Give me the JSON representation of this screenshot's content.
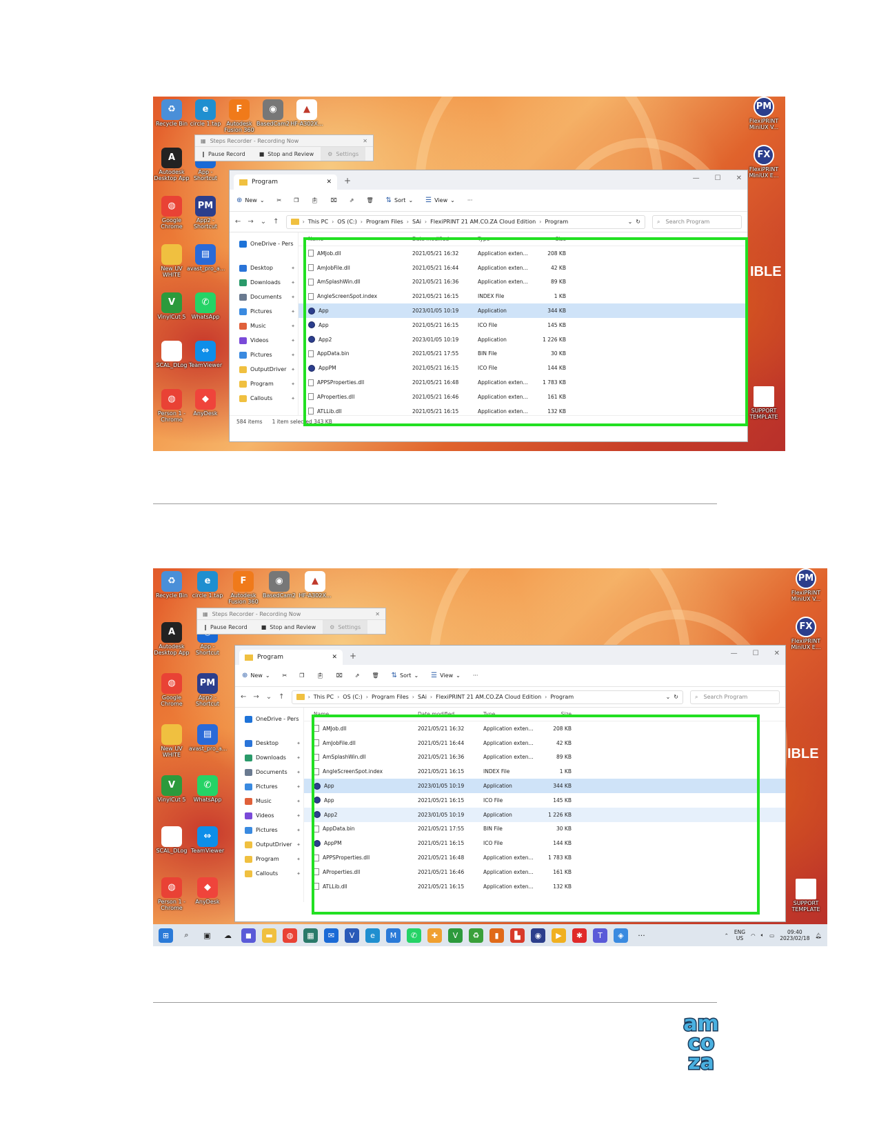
{
  "screens": [
    {
      "desktop_icons": [
        {
          "label": "Recycle Bin",
          "icon": "recycle-bin-icon",
          "color": "#4a8fd8",
          "glyph": "♻"
        },
        {
          "label": "circle 1.tap",
          "icon": "edge-icon",
          "color": "#1f8fd0",
          "glyph": "e"
        },
        {
          "label": "Autodesk Fusion 360",
          "icon": "fusion-icon",
          "color": "#f07a1a",
          "glyph": "F"
        },
        {
          "label": "BasedCam2",
          "icon": "camera-icon",
          "color": "#777777",
          "glyph": "◉"
        },
        {
          "label": "HF-A302X...",
          "icon": "triangle-app-icon",
          "color": "#ffffff",
          "glyph": "▲"
        },
        {
          "label": "Autodesk Desktop App",
          "icon": "autodesk-icon",
          "color": "#222222",
          "glyph": "A"
        },
        {
          "label": "App - Shortcut",
          "icon": "app-shortcut-icon",
          "color": "#1a6ad6",
          "glyph": "◎"
        },
        {
          "label": "Google Chrome",
          "icon": "chrome-icon",
          "color": "#e94235",
          "glyph": "◍"
        },
        {
          "label": "App2 - Shortcut",
          "icon": "pm-icon",
          "color": "#2c3e8c",
          "glyph": "PM"
        },
        {
          "label": "New UV WHITE",
          "icon": "folder-icon",
          "color": "#f0c040",
          "glyph": ""
        },
        {
          "label": "avast_pro_a...",
          "icon": "archive-icon",
          "color": "#2a6ad8",
          "glyph": "▤"
        },
        {
          "label": "VinylCut 5",
          "icon": "vinylcut-icon",
          "color": "#2c9a3c",
          "glyph": "V"
        },
        {
          "label": "WhatsApp",
          "icon": "whatsapp-icon",
          "color": "#25d366",
          "glyph": "✆"
        },
        {
          "label": "SCAL_DLog",
          "icon": "document-icon",
          "color": "#ffffff",
          "glyph": ""
        },
        {
          "label": "TeamViewer",
          "icon": "teamviewer-icon",
          "color": "#0e8ee9",
          "glyph": "⇔"
        },
        {
          "label": "Person 1 - Chrome",
          "icon": "chrome-profile-icon",
          "color": "#e94235",
          "glyph": "◍"
        },
        {
          "label": "AnyDesk",
          "icon": "anydesk-icon",
          "color": "#ef443b",
          "glyph": "◆"
        }
      ],
      "right_icons": [
        {
          "label": "FlexiPRINT MiniUX V...",
          "icon": "pm-circle-icon",
          "glyph": "PM"
        },
        {
          "label": "FlexiPRINT MiniUX E...",
          "icon": "fx-circle-icon",
          "glyph": "FX"
        },
        {
          "label": "SUPPORT TEMPLATE",
          "icon": "support-doc-icon",
          "glyph": ""
        }
      ],
      "wallpaper_text": "IBLE"
    }
  ],
  "steps_recorder": {
    "title": "Steps Recorder - Recording Now",
    "pause": "Pause Record",
    "stop": "Stop and Review",
    "settings": "Settings"
  },
  "explorer": {
    "tab_title": "Program",
    "commands": {
      "new": "New",
      "sort": "Sort",
      "view": "View",
      "more": "···"
    },
    "breadcrumb": [
      "This PC",
      "OS (C:)",
      "Program Files",
      "SAi",
      "FlexiPRINT 21 AM.CO.ZA Cloud Edition",
      "Program"
    ],
    "search_placeholder": "Search Program",
    "nav": [
      {
        "label": "OneDrive - Pers",
        "color": "#1e73d8"
      },
      {
        "label": "Desktop",
        "color": "#2a74d8",
        "pin": true
      },
      {
        "label": "Downloads",
        "color": "#2a9a6a",
        "pin": true
      },
      {
        "label": "Documents",
        "color": "#6a7a90",
        "pin": true
      },
      {
        "label": "Pictures",
        "color": "#3a8ae0",
        "pin": true
      },
      {
        "label": "Music",
        "color": "#e0603a",
        "pin": true
      },
      {
        "label": "Videos",
        "color": "#7a4ad8",
        "pin": true
      },
      {
        "label": "Pictures",
        "color": "#3a8ae0",
        "pin": true
      },
      {
        "label": "OutputDriver",
        "color": "#f0c040",
        "pin": true
      },
      {
        "label": "Program",
        "color": "#f0c040",
        "pin": true
      },
      {
        "label": "Callouts",
        "color": "#f0c040",
        "pin": true
      }
    ],
    "columns": [
      "Name",
      "Date modified",
      "Type",
      "Size"
    ],
    "files": [
      {
        "name": "AMJob.dll",
        "date": "2021/05/21 16:32",
        "type": "Application exten...",
        "size": "208 KB",
        "icon": "doc"
      },
      {
        "name": "AmJobFile.dll",
        "date": "2021/05/21 16:44",
        "type": "Application exten...",
        "size": "42 KB",
        "icon": "doc"
      },
      {
        "name": "AmSplashWin.dll",
        "date": "2021/05/21 16:36",
        "type": "Application exten...",
        "size": "89 KB",
        "icon": "doc"
      },
      {
        "name": "AngleScreenSpot.index",
        "date": "2021/05/21 16:15",
        "type": "INDEX File",
        "size": "1 KB",
        "icon": "doc"
      },
      {
        "name": "App",
        "date": "2023/01/05 10:19",
        "type": "Application",
        "size": "344 KB",
        "icon": "app"
      },
      {
        "name": "App",
        "date": "2021/05/21 16:15",
        "type": "ICO File",
        "size": "145 KB",
        "icon": "app"
      },
      {
        "name": "App2",
        "date": "2023/01/05 10:19",
        "type": "Application",
        "size": "1 226 KB",
        "icon": "app"
      },
      {
        "name": "AppData.bin",
        "date": "2021/05/21 17:55",
        "type": "BIN File",
        "size": "30 KB",
        "icon": "doc"
      },
      {
        "name": "AppPM",
        "date": "2021/05/21 16:15",
        "type": "ICO File",
        "size": "144 KB",
        "icon": "app"
      },
      {
        "name": "APPSProperties.dll",
        "date": "2021/05/21 16:48",
        "type": "Application exten...",
        "size": "1 783 KB",
        "icon": "doc"
      },
      {
        "name": "AProperties.dll",
        "date": "2021/05/21 16:46",
        "type": "Application exten...",
        "size": "161 KB",
        "icon": "doc"
      },
      {
        "name": "ATLLib.dll",
        "date": "2021/05/21 16:15",
        "type": "Application exten...",
        "size": "132 KB",
        "icon": "doc"
      }
    ],
    "status": {
      "count": "584 items",
      "selected": "1 item selected  343 KB"
    }
  },
  "taskbar": {
    "items": [
      {
        "icon": "windows-start-icon",
        "color": "#2a7ad8",
        "glyph": "⊞"
      },
      {
        "icon": "search-icon",
        "color": "",
        "glyph": "⌕"
      },
      {
        "icon": "task-view-icon",
        "color": "",
        "glyph": "▣"
      },
      {
        "icon": "weather-icon",
        "color": "",
        "glyph": "☁"
      },
      {
        "icon": "teams-chat-icon",
        "color": "#5a5ad8",
        "glyph": "◼"
      },
      {
        "icon": "file-explorer-icon",
        "color": "#f0c040",
        "glyph": "▬"
      },
      {
        "icon": "chrome-icon",
        "color": "#e94235",
        "glyph": "◍"
      },
      {
        "icon": "calculator-icon",
        "color": "#2a7a6a",
        "glyph": "▦"
      },
      {
        "icon": "mail-icon",
        "color": "#1a6ad6",
        "glyph": "✉"
      },
      {
        "icon": "vinylcut-icon",
        "color": "#2a5ab8",
        "glyph": "V"
      },
      {
        "icon": "edge-icon",
        "color": "#1f8fd0",
        "glyph": "e"
      },
      {
        "icon": "mcafee-icon",
        "color": "#2a7ad8",
        "glyph": "M"
      },
      {
        "icon": "whatsapp-icon",
        "color": "#25d366",
        "glyph": "✆"
      },
      {
        "icon": "network-app-icon",
        "color": "#f0a030",
        "glyph": "✚"
      },
      {
        "icon": "vinylcut-green-icon",
        "color": "#2c9a3c",
        "glyph": "V"
      },
      {
        "icon": "recycle-app-icon",
        "color": "#3aa03a",
        "glyph": "♻"
      },
      {
        "icon": "orange-app-icon",
        "color": "#e06a1a",
        "glyph": "▮"
      },
      {
        "icon": "red-app-icon",
        "color": "#d83a2a",
        "glyph": "▙"
      },
      {
        "icon": "pm-taskbar-icon",
        "color": "#2c3e8c",
        "glyph": "◉"
      },
      {
        "icon": "media-icon",
        "color": "#f0b020",
        "glyph": "▶"
      },
      {
        "icon": "flexi-icon",
        "color": "#e02a2a",
        "glyph": "✱"
      },
      {
        "icon": "teams-icon",
        "color": "#5a5ad8",
        "glyph": "T"
      },
      {
        "icon": "security-icon",
        "color": "#3a8ae0",
        "glyph": "◈"
      },
      {
        "icon": "more-icon",
        "color": "",
        "glyph": "···"
      }
    ],
    "lang": "ENG",
    "region": "US",
    "time": "09:40",
    "date": "2023/02/18"
  },
  "logo": {
    "lines": [
      "am",
      "co",
      "za"
    ],
    "color": "#4ab0e0"
  }
}
